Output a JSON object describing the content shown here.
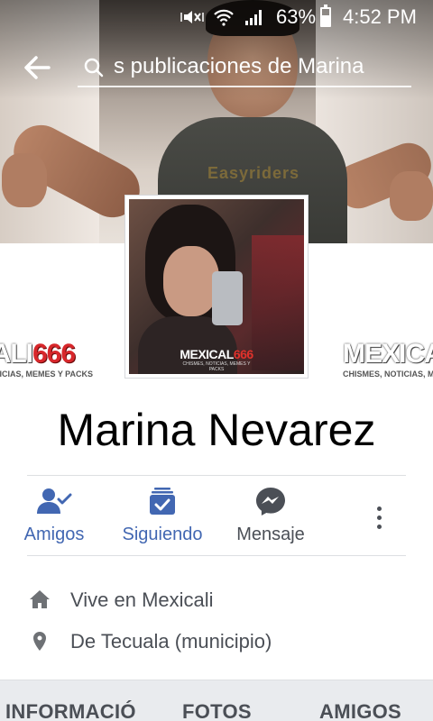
{
  "status_bar": {
    "battery": "63%",
    "time": "4:52 PM",
    "icons": [
      "mute-vibrate-icon",
      "wifi-icon",
      "signal-icon",
      "battery-icon"
    ]
  },
  "header": {
    "search_text": "s publicaciones de Marina",
    "icons": [
      "back-arrow-icon",
      "search-icon"
    ]
  },
  "profile": {
    "name": "Marina Nevarez",
    "picture_brand": "MEXICAL",
    "picture_brand_num": "666",
    "picture_tagline": "CHISMES, NOTICIAS, MEMES Y PACKS"
  },
  "cover": {
    "shirt_text": "Easyriders"
  },
  "side_logos": {
    "left_text": "CALI",
    "left_num": "666",
    "left_tagline": "TICIAS, MEMES Y PACKS",
    "right_text": "MEXICAL",
    "right_tagline": "CHISMES, NOTICIAS, ME"
  },
  "actions": [
    {
      "label": "Amigos",
      "icon": "friends-check-icon",
      "color": "#4267b2"
    },
    {
      "label": "Siguiendo",
      "icon": "following-check-icon",
      "color": "#4267b2"
    },
    {
      "label": "Mensaje",
      "icon": "messenger-icon",
      "color": "#4b4f56"
    }
  ],
  "info": [
    {
      "text": "Vive en Mexicali",
      "icon": "home-icon"
    },
    {
      "text": "De Tecuala (municipio)",
      "icon": "location-pin-icon"
    }
  ],
  "tabs": [
    "INFORMACIÓ",
    "FOTOS",
    "AMIGOS"
  ],
  "colors": {
    "accent": "#4267b2",
    "text_secondary": "#4b4f56",
    "divider": "#dddfe2"
  }
}
